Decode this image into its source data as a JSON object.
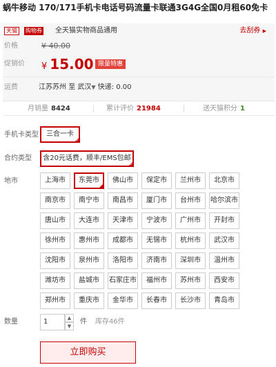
{
  "title": "蜗牛移动 170/171手机卡电话号码流量卡联通3G4G全国0月租60免卡",
  "promo": {
    "badge_tmall": "天猫",
    "badge_shop": "购物券",
    "text": "全天猫实物商品通用",
    "coupon_label": "去刮券",
    "coupon_arrow": "▶"
  },
  "price": {
    "orig_label": "价格",
    "orig_value": "¥ 40.00",
    "cur_label": "促销价",
    "currency": "¥",
    "cur_value": "15.00",
    "tag": "限量特惠"
  },
  "shipping": {
    "label": "运费",
    "from": "江苏苏州",
    "to_word": "至",
    "to": "武汉",
    "arrow": "▼",
    "fee": "快递: 0.00"
  },
  "stats": {
    "monthly_label": "月销量",
    "monthly_value": "8424",
    "review_label": "累计评价",
    "review_value": "21984",
    "points_label": "送天猫积分",
    "points_value": "1"
  },
  "options": {
    "card_type_label": "手机卡类型",
    "card_type_value": "三合一卡",
    "contract_label": "合约类型",
    "contract_value": "含20元话费，顺丰/EMS包邮",
    "region_label": "地市"
  },
  "cities": [
    [
      "上海市",
      "东莞市",
      "佛山市",
      "保定市",
      "兰州市",
      "北京市"
    ],
    [
      "南京市",
      "南宁市",
      "南昌市",
      "厦门市",
      "台州市",
      "哈尔滨市"
    ],
    [
      "唐山市",
      "大连市",
      "天津市",
      "宁波市",
      "广州市",
      "开封市"
    ],
    [
      "徐州市",
      "惠州市",
      "成都市",
      "无锡市",
      "杭州市",
      "武汉市"
    ],
    [
      "沈阳市",
      "泉州市",
      "洛阳市",
      "济南市",
      "深圳市",
      "温州市"
    ],
    [
      "潍坊市",
      "盐城市",
      "石家庄市",
      "福州市",
      "苏州市",
      "西安市"
    ],
    [
      "郑州市",
      "重庆市",
      "金华市",
      "长春市",
      "长沙市",
      "青岛市"
    ]
  ],
  "selected_city": "东莞市",
  "quantity": {
    "label": "数量",
    "value": "1",
    "up": "▲",
    "down": "▼",
    "unit": "件",
    "stock": "库存46件"
  },
  "buy_button": "立即购买"
}
